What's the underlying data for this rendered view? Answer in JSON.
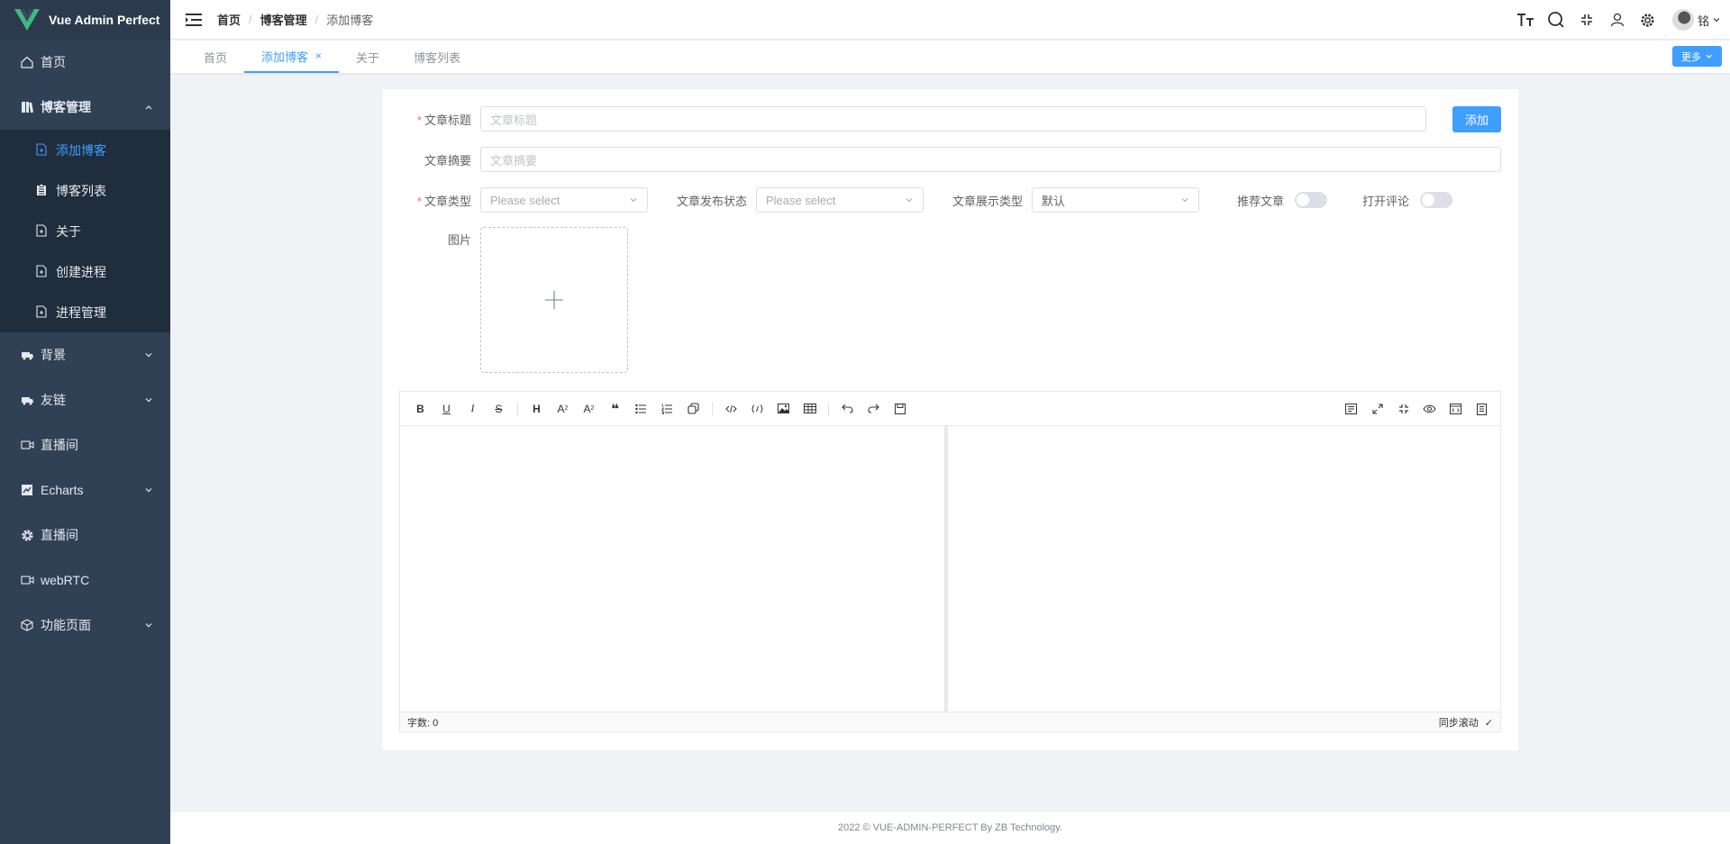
{
  "app": {
    "title": "Vue Admin Perfect"
  },
  "sidebar": {
    "items": [
      {
        "label": "首页"
      },
      {
        "label": "博客管理",
        "children": [
          {
            "label": "添加博客"
          },
          {
            "label": "博客列表"
          },
          {
            "label": "关于"
          },
          {
            "label": "创建进程"
          },
          {
            "label": "进程管理"
          }
        ]
      },
      {
        "label": "背景"
      },
      {
        "label": "友链"
      },
      {
        "label": "直播间"
      },
      {
        "label": "Echarts"
      },
      {
        "label": "直播间"
      },
      {
        "label": "webRTC"
      },
      {
        "label": "功能页面"
      }
    ]
  },
  "header": {
    "breadcrumb": [
      "首页",
      "博客管理",
      "添加博客"
    ],
    "user": "铭"
  },
  "tabs": {
    "items": [
      "首页",
      "添加博客",
      "关于",
      "博客列表"
    ],
    "close": "×",
    "more": "更多"
  },
  "form": {
    "title_label": "文章标题",
    "title_placeholder": "文章标题",
    "add_button": "添加",
    "summary_label": "文章摘要",
    "summary_placeholder": "文章摘要",
    "type_label": "文章类型",
    "type_placeholder": "Please select",
    "status_label": "文章发布状态",
    "status_placeholder": "Please select",
    "display_label": "文章展示类型",
    "display_value": "默认",
    "recommend_label": "推荐文章",
    "comment_label": "打开评论",
    "image_label": "图片",
    "recommend_on": false,
    "comment_on": false
  },
  "editor": {
    "toolbar_left": [
      "B",
      "U",
      "I",
      "S",
      "H",
      "A↓",
      "A↑",
      "❝",
      "ul",
      "ol",
      "copy",
      "code",
      "inline-code",
      "image",
      "table",
      "undo",
      "redo",
      "save"
    ],
    "word_count": "字数: 0",
    "sync_scroll": "同步滚动"
  },
  "footer": {
    "text": "2022 © VUE-ADMIN-PERFECT By ZB Technology."
  },
  "colors": {
    "primary": "#409eff",
    "sidebar": "#304156",
    "submenu": "#1f2d3d"
  }
}
